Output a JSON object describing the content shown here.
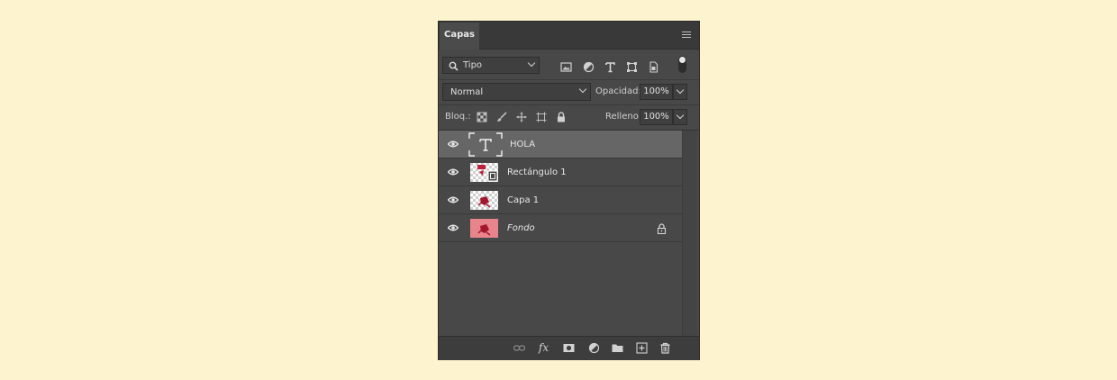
{
  "panel": {
    "tab_label": "Capas"
  },
  "filter": {
    "kind_label": "Tipo",
    "icons": [
      "image-filter-icon",
      "adjustment-filter-icon",
      "type-filter-icon",
      "shape-filter-icon",
      "smart-object-filter-icon"
    ]
  },
  "blend": {
    "mode": "Normal",
    "opacity_label": "Opacidad:",
    "opacity_value": "100%"
  },
  "lock": {
    "label": "Bloq.:",
    "fill_label": "Relleno:",
    "fill_value": "100%"
  },
  "layers": [
    {
      "name": "HOLA",
      "type": "text",
      "selected": true,
      "italic": false,
      "locked": false
    },
    {
      "name": "Rectángulo 1",
      "type": "shape",
      "selected": false,
      "italic": false,
      "locked": false
    },
    {
      "name": "Capa 1",
      "type": "pixel",
      "selected": false,
      "italic": false,
      "locked": false
    },
    {
      "name": "Fondo",
      "type": "background",
      "selected": false,
      "italic": true,
      "locked": true
    }
  ],
  "footer": {
    "fx_label": "fx"
  },
  "colors": {
    "panel_bg": "#484848",
    "selected_row": "#666666",
    "page_bg": "#fdf3cf",
    "thumb_red": "#e8848b"
  }
}
